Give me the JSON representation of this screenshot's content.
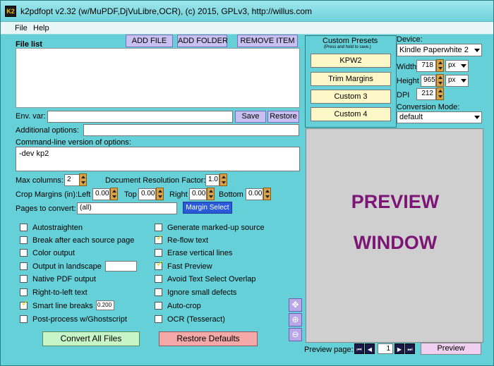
{
  "window": {
    "title": "k2pdfopt v2.32 (w/MuPDF,DjVuLibre,OCR), (c) 2015, GPLv3, http://willus.com",
    "icon": "K2"
  },
  "menu": [
    "File",
    "Help"
  ],
  "file_list": {
    "label": "File list",
    "add_file": "ADD FILE",
    "add_folder": "ADD FOLDER",
    "remove_item": "REMOVE ITEM"
  },
  "env": {
    "label": "Env. var:",
    "value": "",
    "save": "Save",
    "restore": "Restore"
  },
  "additional": {
    "label": "Additional options:",
    "value": ""
  },
  "cmdline": {
    "label": "Command-line version of options:",
    "value": "-dev kp2"
  },
  "options": {
    "max_columns_label": "Max columns:",
    "max_columns": "2",
    "doc_res_label": "Document Resolution Factor:",
    "doc_res": "1.0",
    "crop_label": "Crop Margins (in):",
    "left_label": "Left",
    "left": "0.00",
    "top_label": "Top",
    "top": "0.00",
    "right_label": "Right",
    "right": "0.00",
    "bottom_label": "Bottom",
    "bottom": "0.00",
    "pages_label": "Pages to convert:",
    "pages": "(all)",
    "margin_select": "Margin Select"
  },
  "checkboxes_left": [
    {
      "label": "Autostraighten",
      "checked": false
    },
    {
      "label": "Break after each source page",
      "checked": false
    },
    {
      "label": "Color output",
      "checked": false
    },
    {
      "label": "Output in landscape",
      "checked": false
    },
    {
      "label": "Native PDF output",
      "checked": false
    },
    {
      "label": "Right-to-left text",
      "checked": false
    },
    {
      "label": "Smart line breaks",
      "checked": true,
      "value": "0.200"
    },
    {
      "label": "Post-process w/Ghostscript",
      "checked": false
    }
  ],
  "checkboxes_right": [
    {
      "label": "Generate marked-up source",
      "checked": false
    },
    {
      "label": "Re-flow text",
      "checked": true
    },
    {
      "label": "Erase vertical lines",
      "checked": false
    },
    {
      "label": "Fast Preview",
      "checked": true
    },
    {
      "label": "Avoid Text Select Overlap",
      "checked": false
    },
    {
      "label": "Ignore small defects",
      "checked": false
    },
    {
      "label": "Auto-crop",
      "checked": false
    },
    {
      "label": "OCR (Tesseract)",
      "checked": false
    }
  ],
  "actions": {
    "convert": "Convert All Files",
    "restore_defaults": "Restore Defaults"
  },
  "presets": {
    "title": "Custom Presets",
    "hint": "(Press and hold to save.)",
    "buttons": [
      "KPW2",
      "Trim Margins",
      "Custom 3",
      "Custom 4"
    ]
  },
  "device": {
    "label": "Device:",
    "selected": "Kindle Paperwhite 2",
    "width_label": "Width",
    "width": "718",
    "width_unit": "px",
    "height_label": "Height",
    "height": "965",
    "height_unit": "px",
    "dpi_label": "DPI",
    "dpi": "212",
    "mode_label": "Conversion Mode:",
    "mode": "default"
  },
  "preview": {
    "line1": "PREVIEW",
    "line2": "WINDOW",
    "page_label": "Preview page:",
    "page": "1",
    "button": "Preview"
  }
}
